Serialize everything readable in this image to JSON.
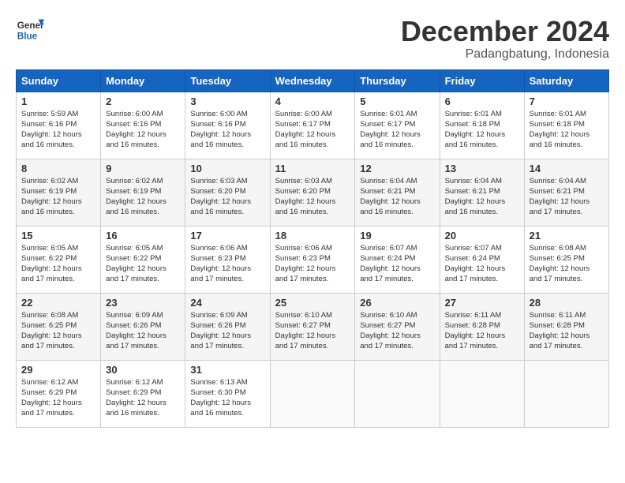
{
  "header": {
    "logo_line1": "General",
    "logo_line2": "Blue",
    "month": "December 2024",
    "location": "Padangbatung, Indonesia"
  },
  "days_of_week": [
    "Sunday",
    "Monday",
    "Tuesday",
    "Wednesday",
    "Thursday",
    "Friday",
    "Saturday"
  ],
  "weeks": [
    [
      {
        "day": "1",
        "sunrise": "Sunrise: 5:59 AM",
        "sunset": "Sunset: 6:16 PM",
        "daylight": "Daylight: 12 hours and 16 minutes."
      },
      {
        "day": "2",
        "sunrise": "Sunrise: 6:00 AM",
        "sunset": "Sunset: 6:16 PM",
        "daylight": "Daylight: 12 hours and 16 minutes."
      },
      {
        "day": "3",
        "sunrise": "Sunrise: 6:00 AM",
        "sunset": "Sunset: 6:16 PM",
        "daylight": "Daylight: 12 hours and 16 minutes."
      },
      {
        "day": "4",
        "sunrise": "Sunrise: 6:00 AM",
        "sunset": "Sunset: 6:17 PM",
        "daylight": "Daylight: 12 hours and 16 minutes."
      },
      {
        "day": "5",
        "sunrise": "Sunrise: 6:01 AM",
        "sunset": "Sunset: 6:17 PM",
        "daylight": "Daylight: 12 hours and 16 minutes."
      },
      {
        "day": "6",
        "sunrise": "Sunrise: 6:01 AM",
        "sunset": "Sunset: 6:18 PM",
        "daylight": "Daylight: 12 hours and 16 minutes."
      },
      {
        "day": "7",
        "sunrise": "Sunrise: 6:01 AM",
        "sunset": "Sunset: 6:18 PM",
        "daylight": "Daylight: 12 hours and 16 minutes."
      }
    ],
    [
      {
        "day": "8",
        "sunrise": "Sunrise: 6:02 AM",
        "sunset": "Sunset: 6:19 PM",
        "daylight": "Daylight: 12 hours and 16 minutes."
      },
      {
        "day": "9",
        "sunrise": "Sunrise: 6:02 AM",
        "sunset": "Sunset: 6:19 PM",
        "daylight": "Daylight: 12 hours and 16 minutes."
      },
      {
        "day": "10",
        "sunrise": "Sunrise: 6:03 AM",
        "sunset": "Sunset: 6:20 PM",
        "daylight": "Daylight: 12 hours and 16 minutes."
      },
      {
        "day": "11",
        "sunrise": "Sunrise: 6:03 AM",
        "sunset": "Sunset: 6:20 PM",
        "daylight": "Daylight: 12 hours and 16 minutes."
      },
      {
        "day": "12",
        "sunrise": "Sunrise: 6:04 AM",
        "sunset": "Sunset: 6:21 PM",
        "daylight": "Daylight: 12 hours and 16 minutes."
      },
      {
        "day": "13",
        "sunrise": "Sunrise: 6:04 AM",
        "sunset": "Sunset: 6:21 PM",
        "daylight": "Daylight: 12 hours and 16 minutes."
      },
      {
        "day": "14",
        "sunrise": "Sunrise: 6:04 AM",
        "sunset": "Sunset: 6:21 PM",
        "daylight": "Daylight: 12 hours and 17 minutes."
      }
    ],
    [
      {
        "day": "15",
        "sunrise": "Sunrise: 6:05 AM",
        "sunset": "Sunset: 6:22 PM",
        "daylight": "Daylight: 12 hours and 17 minutes."
      },
      {
        "day": "16",
        "sunrise": "Sunrise: 6:05 AM",
        "sunset": "Sunset: 6:22 PM",
        "daylight": "Daylight: 12 hours and 17 minutes."
      },
      {
        "day": "17",
        "sunrise": "Sunrise: 6:06 AM",
        "sunset": "Sunset: 6:23 PM",
        "daylight": "Daylight: 12 hours and 17 minutes."
      },
      {
        "day": "18",
        "sunrise": "Sunrise: 6:06 AM",
        "sunset": "Sunset: 6:23 PM",
        "daylight": "Daylight: 12 hours and 17 minutes."
      },
      {
        "day": "19",
        "sunrise": "Sunrise: 6:07 AM",
        "sunset": "Sunset: 6:24 PM",
        "daylight": "Daylight: 12 hours and 17 minutes."
      },
      {
        "day": "20",
        "sunrise": "Sunrise: 6:07 AM",
        "sunset": "Sunset: 6:24 PM",
        "daylight": "Daylight: 12 hours and 17 minutes."
      },
      {
        "day": "21",
        "sunrise": "Sunrise: 6:08 AM",
        "sunset": "Sunset: 6:25 PM",
        "daylight": "Daylight: 12 hours and 17 minutes."
      }
    ],
    [
      {
        "day": "22",
        "sunrise": "Sunrise: 6:08 AM",
        "sunset": "Sunset: 6:25 PM",
        "daylight": "Daylight: 12 hours and 17 minutes."
      },
      {
        "day": "23",
        "sunrise": "Sunrise: 6:09 AM",
        "sunset": "Sunset: 6:26 PM",
        "daylight": "Daylight: 12 hours and 17 minutes."
      },
      {
        "day": "24",
        "sunrise": "Sunrise: 6:09 AM",
        "sunset": "Sunset: 6:26 PM",
        "daylight": "Daylight: 12 hours and 17 minutes."
      },
      {
        "day": "25",
        "sunrise": "Sunrise: 6:10 AM",
        "sunset": "Sunset: 6:27 PM",
        "daylight": "Daylight: 12 hours and 17 minutes."
      },
      {
        "day": "26",
        "sunrise": "Sunrise: 6:10 AM",
        "sunset": "Sunset: 6:27 PM",
        "daylight": "Daylight: 12 hours and 17 minutes."
      },
      {
        "day": "27",
        "sunrise": "Sunrise: 6:11 AM",
        "sunset": "Sunset: 6:28 PM",
        "daylight": "Daylight: 12 hours and 17 minutes."
      },
      {
        "day": "28",
        "sunrise": "Sunrise: 6:11 AM",
        "sunset": "Sunset: 6:28 PM",
        "daylight": "Daylight: 12 hours and 17 minutes."
      }
    ],
    [
      {
        "day": "29",
        "sunrise": "Sunrise: 6:12 AM",
        "sunset": "Sunset: 6:29 PM",
        "daylight": "Daylight: 12 hours and 17 minutes."
      },
      {
        "day": "30",
        "sunrise": "Sunrise: 6:12 AM",
        "sunset": "Sunset: 6:29 PM",
        "daylight": "Daylight: 12 hours and 16 minutes."
      },
      {
        "day": "31",
        "sunrise": "Sunrise: 6:13 AM",
        "sunset": "Sunset: 6:30 PM",
        "daylight": "Daylight: 12 hours and 16 minutes."
      },
      null,
      null,
      null,
      null
    ]
  ]
}
